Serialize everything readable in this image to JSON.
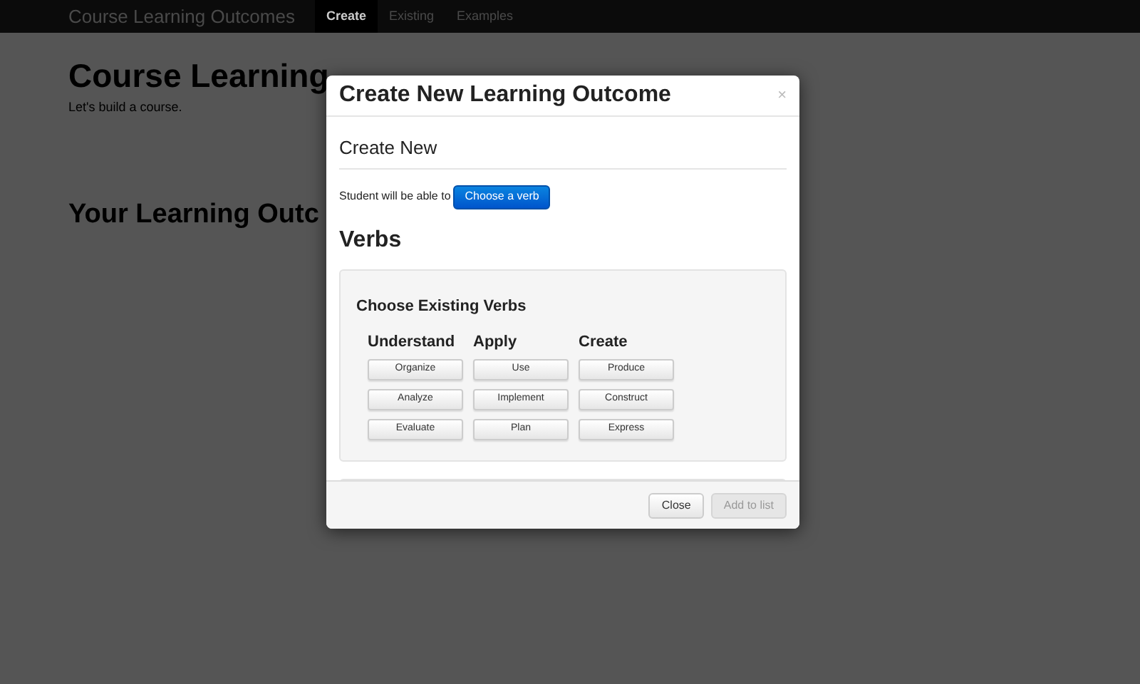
{
  "navbar": {
    "brand": "Course Learning Outcomes",
    "items": [
      {
        "label": "Create",
        "selected": true
      },
      {
        "label": "Existing",
        "selected": false
      },
      {
        "label": "Examples",
        "selected": false
      }
    ]
  },
  "page": {
    "title": "Course Learning",
    "subtitle": "Let's build a course.",
    "section_title": "Your Learning Outc"
  },
  "modal": {
    "title": "Create New Learning Outcome",
    "close": "×",
    "section": "Create New",
    "sentence": "Student will be able to",
    "verb_button": "Choose a verb",
    "verbs_title": "Verbs",
    "well_title": "Choose Existing Verbs",
    "columns": [
      {
        "heading": "Understand",
        "verbs": [
          "Organize",
          "Analyze",
          "Evaluate"
        ]
      },
      {
        "heading": "Apply",
        "verbs": [
          "Use",
          "Implement",
          "Plan"
        ]
      },
      {
        "heading": "Create",
        "verbs": [
          "Produce",
          "Construct",
          "Express"
        ]
      }
    ],
    "buttons": [
      {
        "label": "Close",
        "disabled": false
      },
      {
        "label": "Add to list",
        "disabled": true
      }
    ]
  }
}
